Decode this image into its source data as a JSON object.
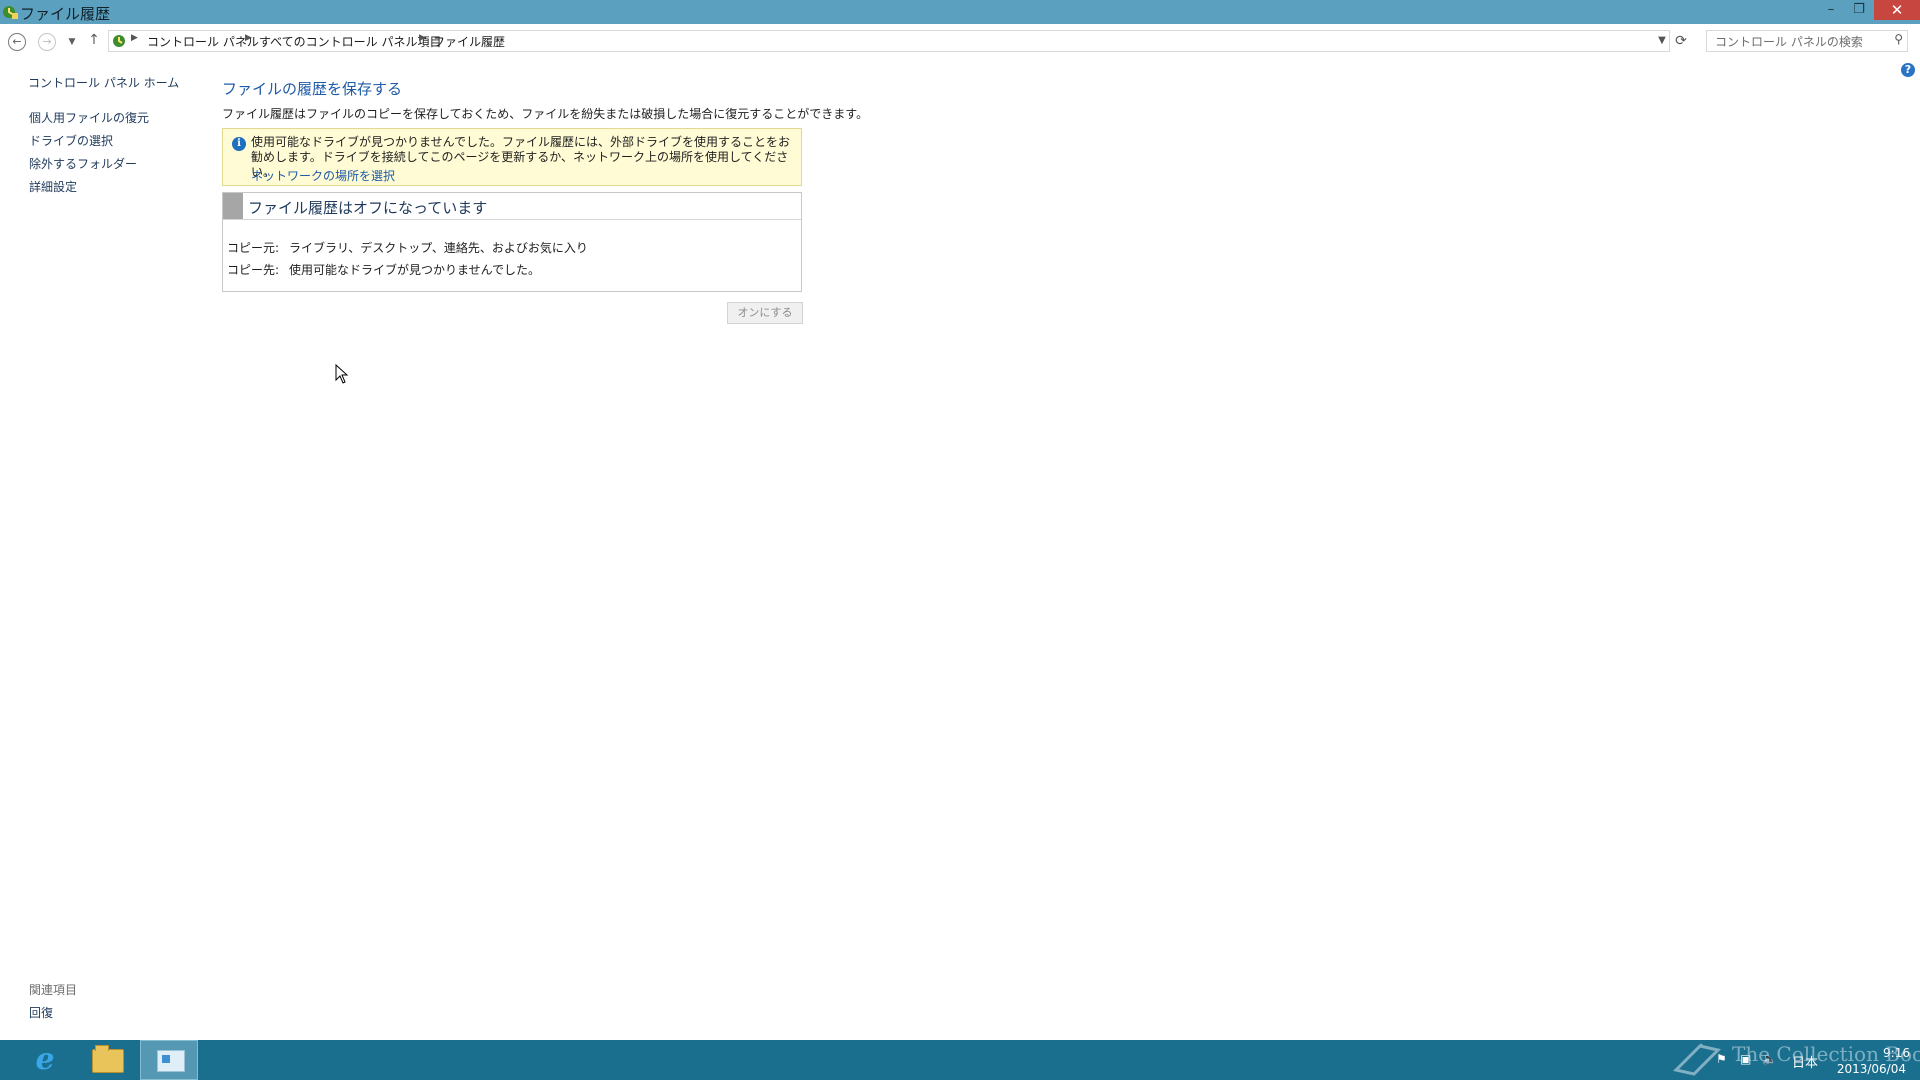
{
  "window": {
    "title": "ファイル履歴",
    "minimize_label": "–",
    "maximize_label": "❐",
    "close_label": "✕"
  },
  "nav": {
    "back_icon": "back-arrow-icon",
    "forward_icon": "forward-arrow-icon",
    "recent_icon": "chevron-down-icon",
    "up_icon": "up-arrow-icon",
    "breadcrumbs": [
      "コントロール パネル",
      "すべてのコントロール パネル項目",
      "ファイル履歴"
    ],
    "refresh_icon": "refresh-icon",
    "search_placeholder": "コントロール パネルの検索"
  },
  "sidebar": {
    "home_label": "コントロール パネル ホーム",
    "items": [
      {
        "label": "個人用ファイルの復元"
      },
      {
        "label": "ドライブの選択"
      },
      {
        "label": "除外するフォルダー"
      },
      {
        "label": "詳細設定"
      }
    ],
    "related_heading": "関連項目",
    "related_items": [
      {
        "label": "回復"
      }
    ]
  },
  "main": {
    "title": "ファイルの履歴を保存する",
    "description": "ファイル履歴はファイルのコピーを保存しておくため、ファイルを紛失または破損した場合に復元することができます。",
    "info": {
      "text": "使用可能なドライブが見つかりませんでした。ファイル履歴には、外部ドライブを使用することをお勧めします。ドライブを接続してこのページを更新するか、ネットワーク上の場所を使用してください。",
      "link": "ネットワークの場所を選択"
    },
    "status": {
      "title": "ファイル履歴はオフになっています",
      "copy_from_label": "コピー元:",
      "copy_from_value": "ライブラリ、デスクトップ、連絡先、およびお気に入り",
      "copy_to_label": "コピー先:",
      "copy_to_value": "使用可能なドライブが見つかりませんでした。"
    },
    "turn_on_button": "オンにする"
  },
  "taskbar": {
    "ime_label": "日本",
    "clock_time": "9:16",
    "clock_date": "2013/06/04",
    "watermark": "The Collection Book"
  },
  "colors": {
    "titlebar": "#5ba1bf",
    "taskbar": "#1b6f8e",
    "link": "#1e395b",
    "heading": "#1e5aa8",
    "info_background": "#fffbd4"
  }
}
